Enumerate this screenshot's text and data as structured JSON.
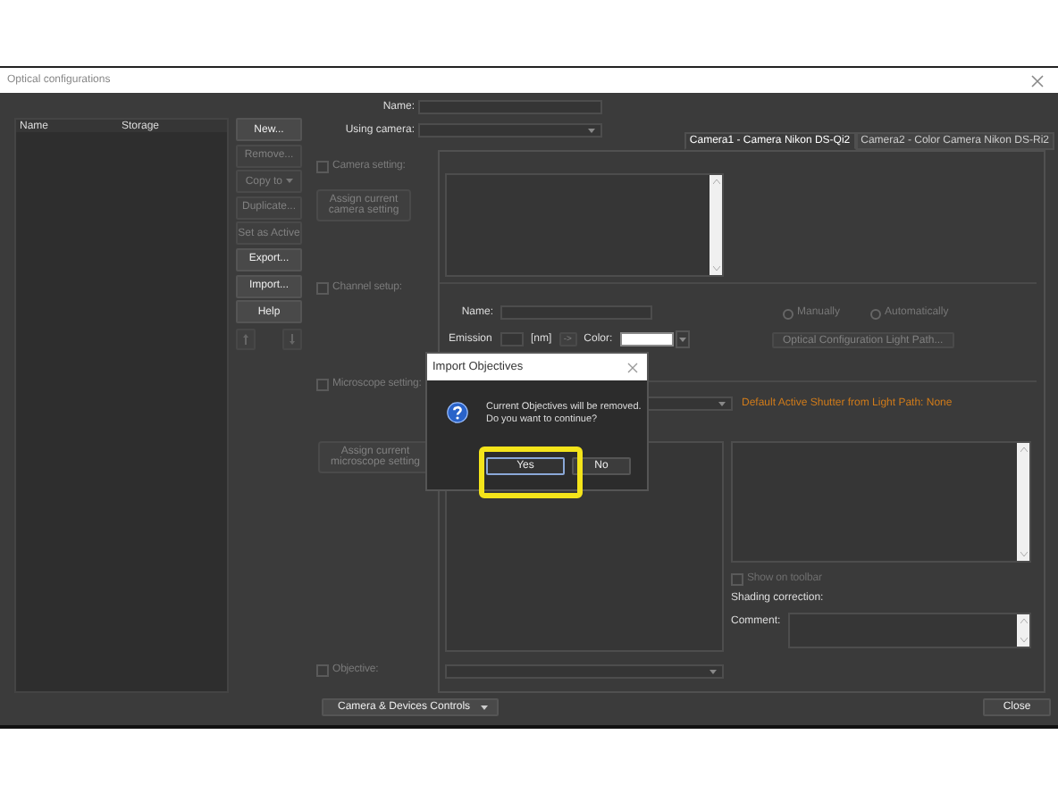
{
  "window": {
    "title": "Optical configurations"
  },
  "config_list": {
    "columns": [
      "Name",
      "Storage"
    ]
  },
  "actions": [
    {
      "kind": "button",
      "label": "New...",
      "disabled": false
    },
    {
      "kind": "button",
      "label": "Remove...",
      "disabled": true
    },
    {
      "kind": "dropdown",
      "label": "Copy to",
      "disabled": true
    },
    {
      "kind": "button",
      "label": "Duplicate...",
      "disabled": true
    },
    {
      "kind": "button",
      "label": "Set as Active",
      "disabled": true
    },
    {
      "kind": "button",
      "label": "Export...",
      "disabled": false
    },
    {
      "kind": "button",
      "label": "Import...",
      "disabled": false
    },
    {
      "kind": "button",
      "label": "Help",
      "disabled": false
    }
  ],
  "form": {
    "name_label": "Name:",
    "camera_label": "Using camera:"
  },
  "camera_tabs": [
    {
      "label": "Camera1 - Camera Nikon DS-Qi2",
      "selected": true
    },
    {
      "label": "Camera2 - Color Camera Nikon DS-Ri2",
      "selected": false
    }
  ],
  "camera_setting": {
    "label": "Camera setting:",
    "checked": false,
    "assign_button": "Assign current camera setting"
  },
  "channel_setup": {
    "label": "Channel setup:",
    "checked": false,
    "name_label": "Name:",
    "emission_label": "Emission",
    "unit": "[nm]",
    "arrow_button": "->",
    "color_label": "Color:",
    "modes": [
      {
        "label": "Manually",
        "selected": false
      },
      {
        "label": "Automatically",
        "selected": false
      }
    ],
    "light_path_button": "Optical Configuration Light Path..."
  },
  "microscope_setting": {
    "label": "Microscope setting:",
    "checked": false,
    "assign_button": "Assign current microscope setting",
    "shutter_note": "Default Active Shutter from Light Path: None",
    "show_on_toolbar": {
      "label": "Show on toolbar",
      "checked": false
    },
    "shading_label": "Shading correction:",
    "comment_label": "Comment:"
  },
  "objective": {
    "label": "Objective:",
    "checked": false
  },
  "bottom": {
    "devices_button": "Camera & Devices Controls",
    "close_button": "Close"
  },
  "dialog": {
    "title": "Import Objectives",
    "message": "Current Objectives will be removed.\nDo you want to continue?",
    "buttons": [
      {
        "label": "Yes",
        "selected": true
      },
      {
        "label": "No",
        "selected": false
      }
    ]
  }
}
